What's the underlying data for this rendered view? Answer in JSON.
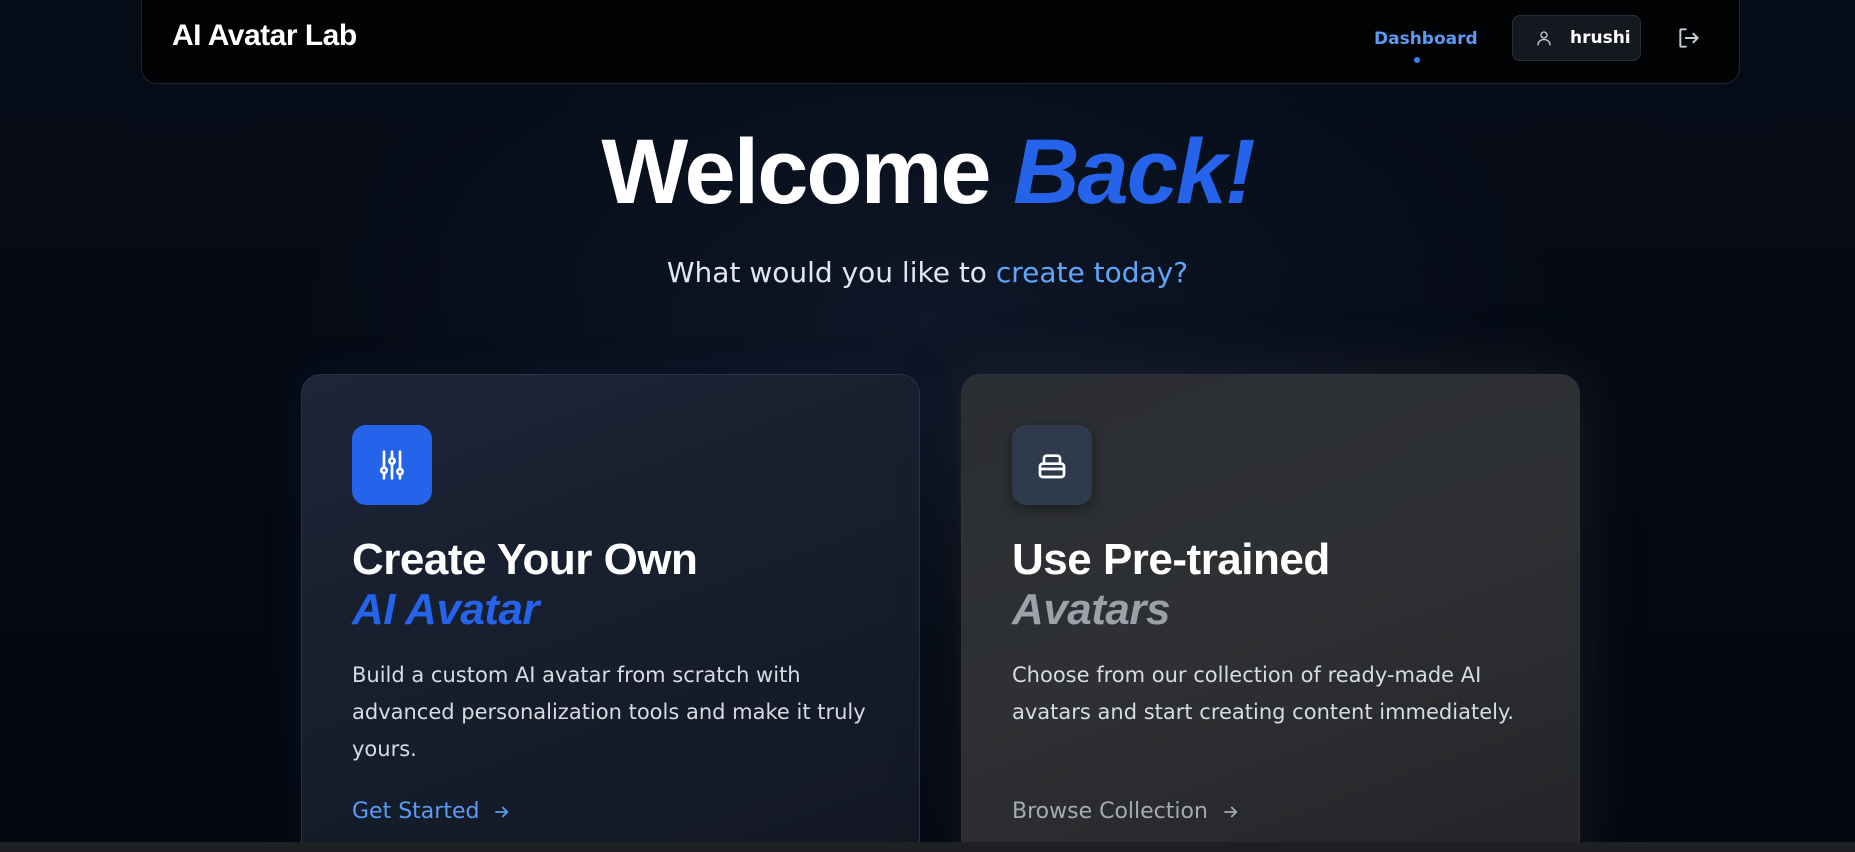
{
  "header": {
    "brand": "AI Avatar Lab",
    "nav_dashboard": "Dashboard",
    "user_name": "hrushi",
    "icons": {
      "user": "user-icon",
      "logout": "logout-icon"
    }
  },
  "hero": {
    "title_main": "Welcome",
    "title_accent": "Back!",
    "subtitle_main": "What would you like to",
    "subtitle_accent": "create today?"
  },
  "cards": [
    {
      "icon": "sliders-icon",
      "title_line1": "Create Your Own",
      "title_line2": "AI Avatar",
      "description": "Build a custom AI avatar from scratch with advanced personalization tools and make it truly yours.",
      "link": "Get Started"
    },
    {
      "icon": "container-icon",
      "title_line1": "Use Pre-trained",
      "title_line2": "Avatars",
      "description": "Choose from our collection of ready-made AI avatars and start creating content immediately.",
      "link": "Browse Collection"
    }
  ],
  "colors": {
    "accent_blue": "#2563eb",
    "link_blue": "#5b9bf5",
    "background": "#050a14"
  }
}
